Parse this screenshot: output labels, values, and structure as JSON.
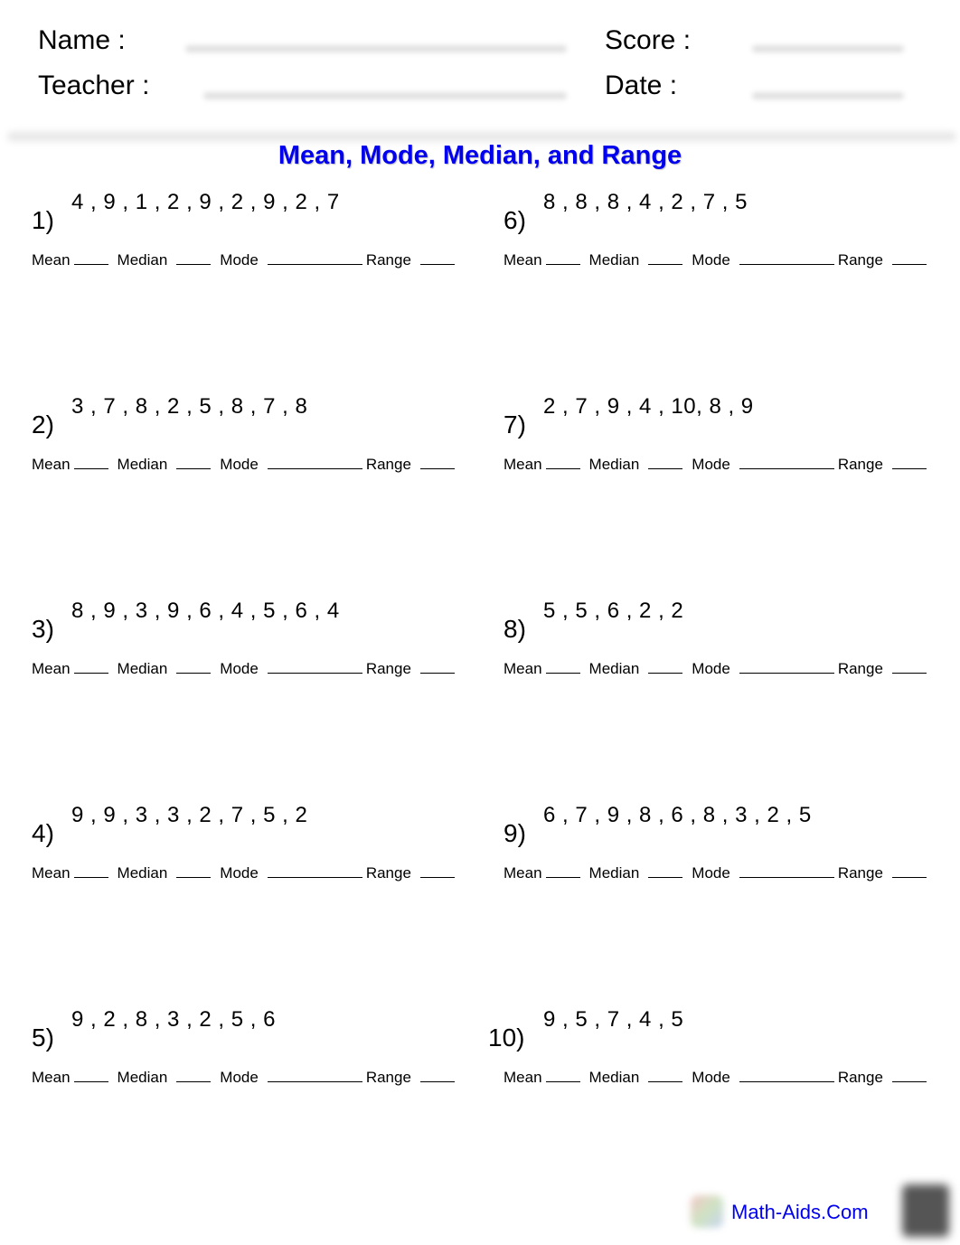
{
  "header": {
    "name_label": "Name :",
    "teacher_label": "Teacher :",
    "score_label": "Score :",
    "date_label": "Date :"
  },
  "title": "Mean, Mode, Median, and Range",
  "answer_labels": {
    "mean": "Mean",
    "median": "Median",
    "mode": "Mode",
    "range": "Range"
  },
  "problems": [
    {
      "number": "1)",
      "data": "4 , 9 , 1 , 2 , 9 , 2 , 9 , 2 , 7"
    },
    {
      "number": "2)",
      "data": "3 , 7 , 8 , 2 , 5 , 8 , 7 , 8"
    },
    {
      "number": "3)",
      "data": "8 , 9 , 3 , 9 , 6 , 4 , 5 , 6 , 4"
    },
    {
      "number": "4)",
      "data": "9 , 9 , 3 , 3 , 2 , 7 , 5 , 2"
    },
    {
      "number": "5)",
      "data": "9 , 2 , 8 , 3 , 2 , 5 , 6"
    },
    {
      "number": "6)",
      "data": "8 , 8 , 8 , 4 , 2 , 7 , 5"
    },
    {
      "number": "7)",
      "data": "2 , 7 , 9 , 4 , 10, 8 , 9"
    },
    {
      "number": "8)",
      "data": "5 , 5 , 6 , 2 , 2"
    },
    {
      "number": "9)",
      "data": "6 , 7 , 9 , 8 , 6 , 8 , 3 , 2 , 5"
    },
    {
      "number": "10)",
      "data": "9 , 5 , 7 , 4 , 5"
    }
  ],
  "footer": {
    "site": "Math-Aids.Com"
  }
}
